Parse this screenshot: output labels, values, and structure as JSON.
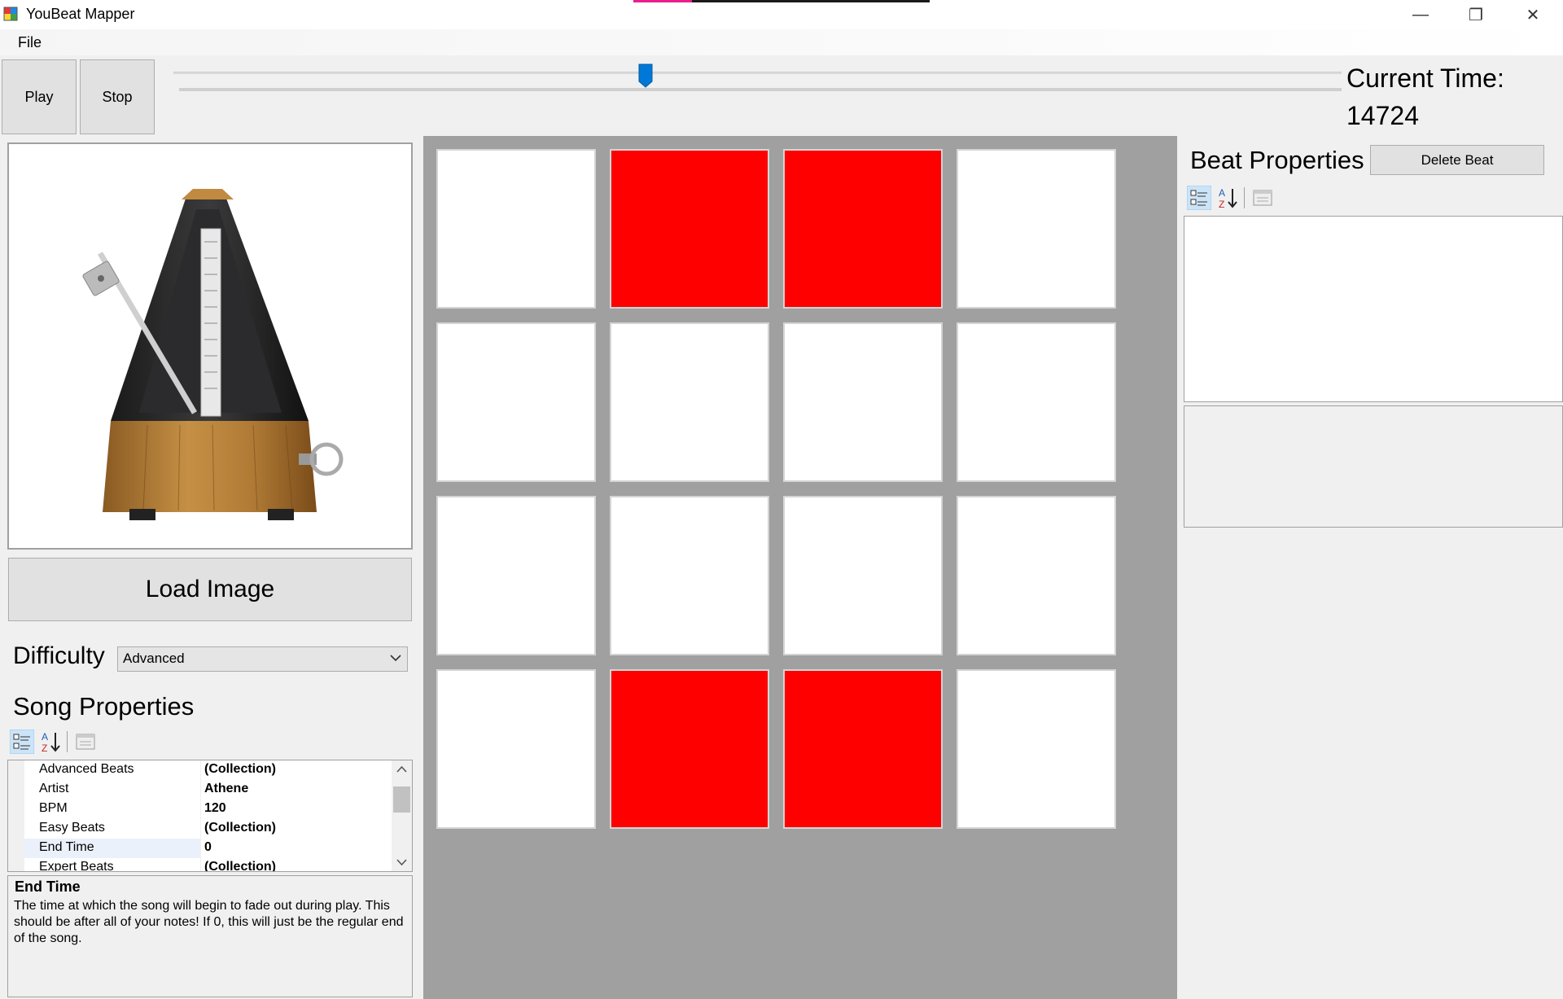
{
  "window": {
    "title": "YouBeat Mapper",
    "controls": {
      "minimize": "—",
      "restore": "❐",
      "close": "✕"
    }
  },
  "menu": {
    "file": "File"
  },
  "transport": {
    "play_label": "Play",
    "stop_label": "Stop",
    "slider_fraction": 0.4,
    "current_time_label": "Current Time:",
    "current_time_value": "14724"
  },
  "left": {
    "image_name": "metronome",
    "load_image_label": "Load Image",
    "difficulty_label": "Difficulty",
    "difficulty_value": "Advanced",
    "song_properties_title": "Song Properties",
    "properties": [
      {
        "name": "Advanced Beats",
        "value": "(Collection)"
      },
      {
        "name": "Artist",
        "value": "Athene"
      },
      {
        "name": "BPM",
        "value": "120"
      },
      {
        "name": "Easy Beats",
        "value": "(Collection)"
      },
      {
        "name": "End Time",
        "value": "0"
      },
      {
        "name": "Expert Beats",
        "value": "(Collection)"
      }
    ],
    "help_title": "End Time",
    "help_text": "The time at which the song will begin to fade out during play. This should be after all of your notes! If 0, this will just be the regular end of the song."
  },
  "grid": {
    "rows": [
      [
        false,
        true,
        true,
        false
      ],
      [
        false,
        false,
        false,
        false
      ],
      [
        false,
        false,
        false,
        false
      ],
      [
        false,
        true,
        true,
        false
      ]
    ],
    "active_color": "#ff0000",
    "inactive_color": "#ffffff"
  },
  "right": {
    "beat_properties_title": "Beat Properties",
    "delete_beat_label": "Delete Beat"
  },
  "toolbar_icons": [
    "categorized-icon",
    "alphabetical-sort-icon",
    "property-pages-icon"
  ]
}
